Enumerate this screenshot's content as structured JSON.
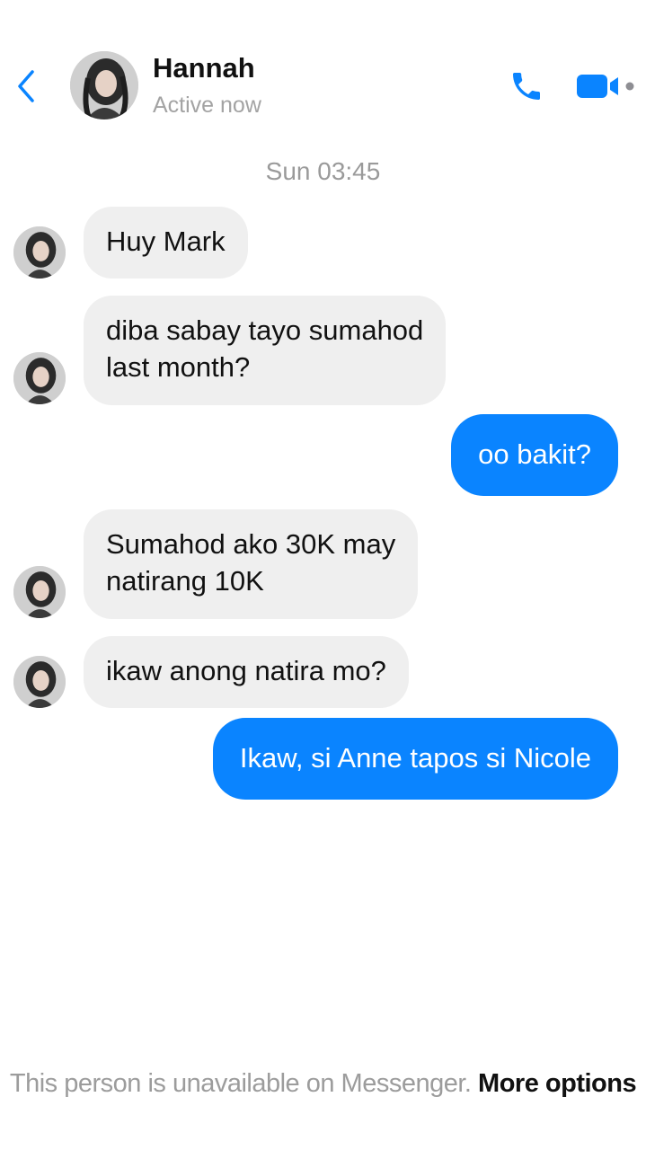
{
  "header": {
    "contact_name": "Hannah",
    "status": "Active now",
    "icons": {
      "back": "chevron-left-icon",
      "call": "phone-icon",
      "video": "video-camera-icon"
    },
    "accent_color": "#0a84ff"
  },
  "conversation": {
    "timestamp": "Sun 03:45",
    "messages": [
      {
        "from": "Hannah",
        "line1": "Huy Mark",
        "line2": ""
      },
      {
        "from": "Hannah",
        "line1": "diba sabay tayo sumahod",
        "line2": "last month?"
      },
      {
        "from": "me",
        "line1": "oo bakit?",
        "line2": ""
      },
      {
        "from": "Hannah",
        "line1": "Sumahod ako 30K may",
        "line2": "natirang 10K"
      },
      {
        "from": "Hannah",
        "line1": "ikaw anong natira mo?",
        "line2": ""
      },
      {
        "from": "me",
        "line1": "Ikaw, si Anne tapos si Nicole",
        "line2": ""
      }
    ]
  },
  "footer": {
    "notice": "This person is unavailable on Messenger.",
    "link": "More options"
  }
}
